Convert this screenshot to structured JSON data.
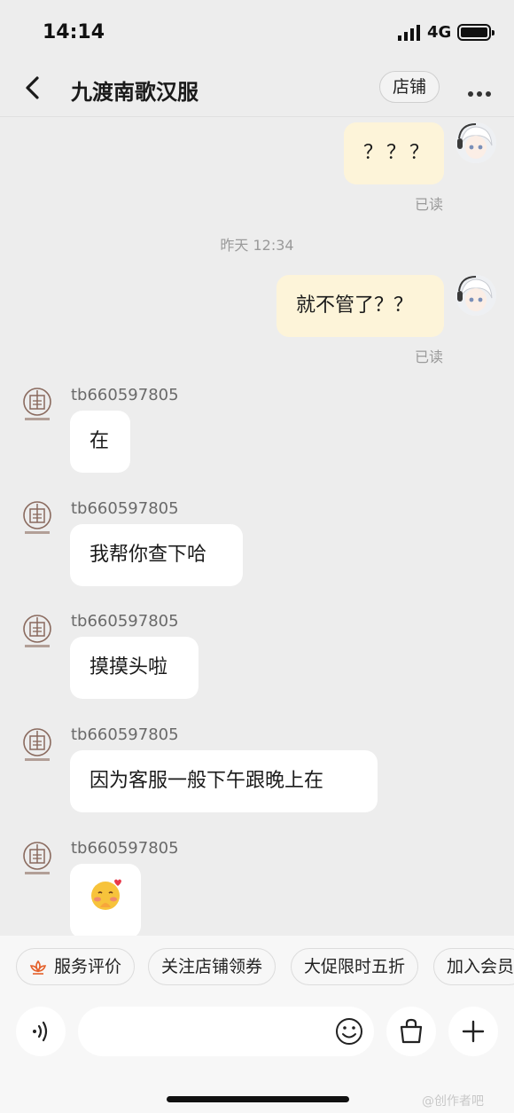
{
  "status_bar": {
    "time": "14:14",
    "network": "4G"
  },
  "header": {
    "title": "九渡南歌汉服",
    "shop_button": "店铺"
  },
  "messages": {
    "m1": {
      "text": "？？？",
      "read": "已读"
    },
    "timestamp": "昨天 12:34",
    "m2": {
      "text": "就不管了？？",
      "read": "已读"
    },
    "sender": "tb660597805",
    "r1": "在",
    "r2": "我帮你查下哈",
    "r3": "摸摸头啦",
    "r4": "因为客服一般下午跟晚上在",
    "r5": "🥰"
  },
  "quick_replies": [
    "服务评价",
    "关注店铺领券",
    "大促限时五折",
    "加入会员"
  ],
  "watermark": "@创作者吧",
  "colors": {
    "my_bubble": "#fdf4d9",
    "their_bubble": "#ffffff",
    "accent": "#e4602a"
  }
}
